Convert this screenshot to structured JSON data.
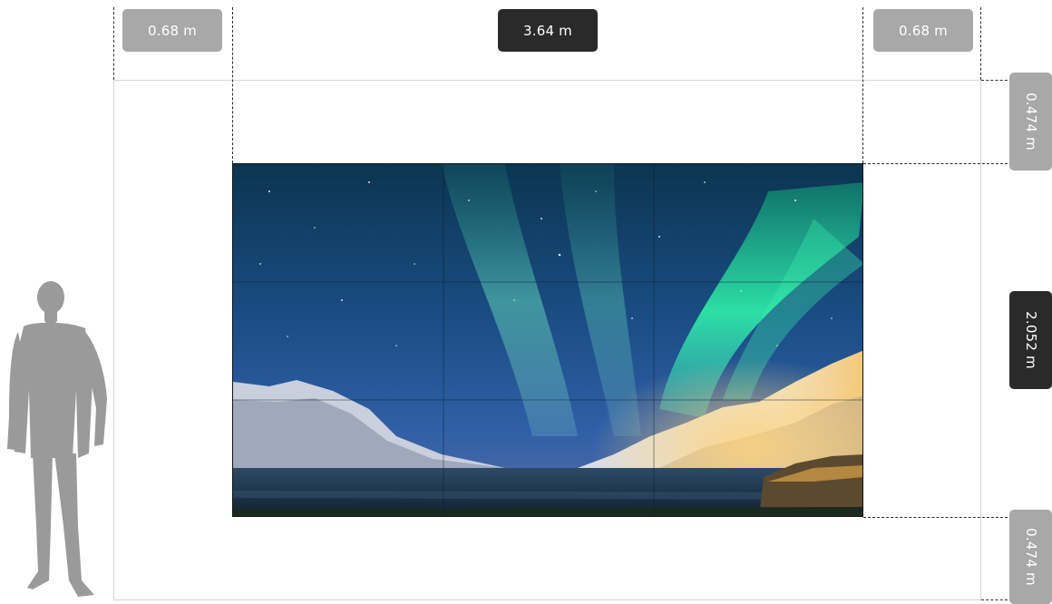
{
  "dimensions": {
    "left_margin": "0.68 m",
    "screen_width": "3.64 m",
    "right_margin": "0.68 m",
    "top_margin": "0.474 m",
    "screen_height": "2.052 m",
    "bottom_margin": "0.474 m"
  },
  "colors": {
    "label_light": "#a8a8a8",
    "label_dark": "#2a2a2a",
    "silhouette": "#9a9a9a",
    "outline": "#d4d4d4"
  },
  "wall": {
    "grid_columns": 3,
    "grid_rows": 3,
    "content": "aurora-landscape-image"
  },
  "icons": {
    "person": "human-silhouette-icon"
  }
}
